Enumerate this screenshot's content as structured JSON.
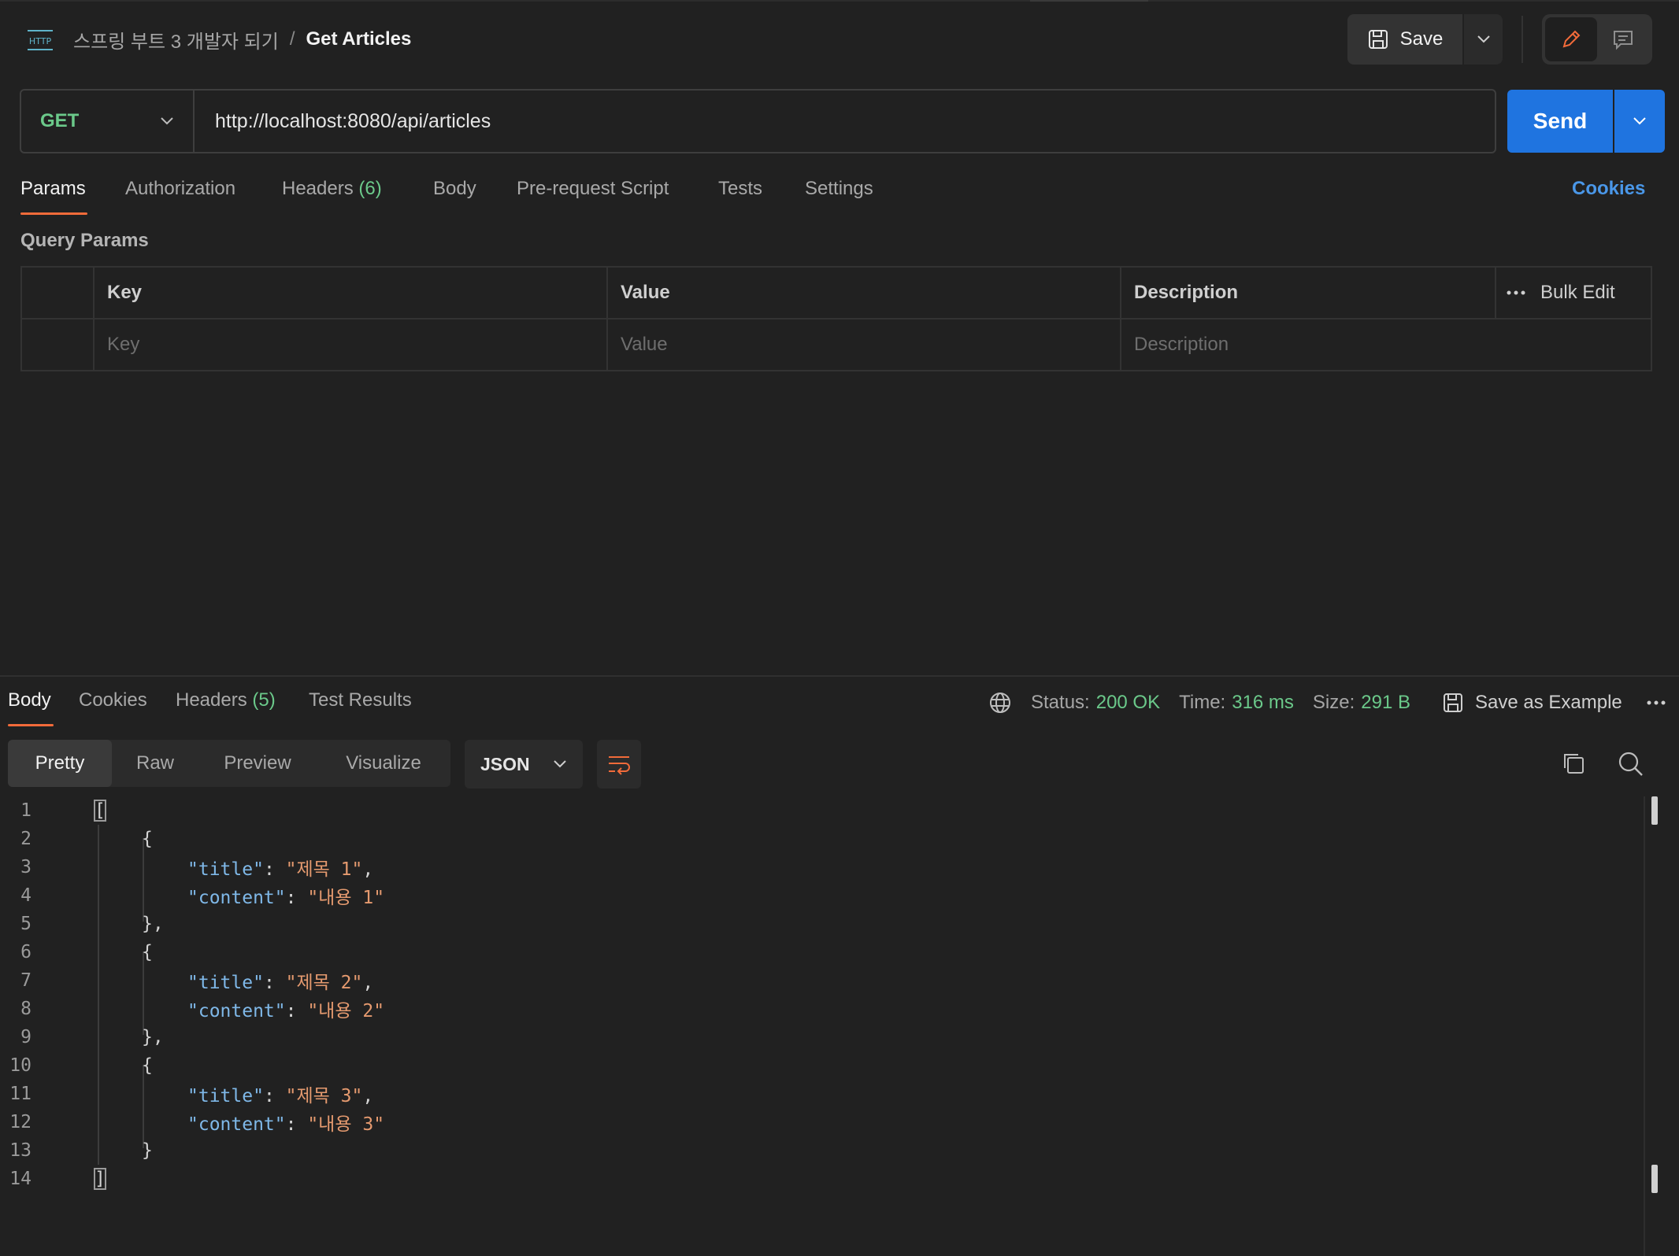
{
  "header": {
    "icon_text": "HTTP",
    "breadcrumb": [
      "스프링 부트 3 개발자 되기",
      "Get Articles"
    ],
    "separator": "/",
    "save_label": "Save"
  },
  "request": {
    "method": "GET",
    "url": "http://localhost:8080/api/articles",
    "send_label": "Send"
  },
  "request_tabs": {
    "params": "Params",
    "authorization": "Authorization",
    "headers": "Headers",
    "headers_count": "(6)",
    "body": "Body",
    "pre_request": "Pre-request Script",
    "tests": "Tests",
    "settings": "Settings",
    "cookies": "Cookies"
  },
  "query_params": {
    "title": "Query Params",
    "columns": {
      "key": "Key",
      "value": "Value",
      "description": "Description"
    },
    "bulk_edit": "Bulk Edit",
    "placeholders": {
      "key": "Key",
      "value": "Value",
      "description": "Description"
    }
  },
  "response_tabs": {
    "body": "Body",
    "cookies": "Cookies",
    "headers": "Headers",
    "headers_count": "(5)",
    "test_results": "Test Results"
  },
  "response_status": {
    "status_label": "Status:",
    "status_value": "200 OK",
    "time_label": "Time:",
    "time_value": "316 ms",
    "size_label": "Size:",
    "size_value": "291 B",
    "save_example": "Save as Example"
  },
  "view_modes": {
    "pretty": "Pretty",
    "raw": "Raw",
    "preview": "Preview",
    "visualize": "Visualize",
    "format": "JSON"
  },
  "code": {
    "line_numbers": [
      "1",
      "2",
      "3",
      "4",
      "5",
      "6",
      "7",
      "8",
      "9",
      "10",
      "11",
      "12",
      "13",
      "14"
    ],
    "l1": "[",
    "l2": "{",
    "l3_key": "\"title\"",
    "l3_val": "\"제목 1\"",
    "l4_key": "\"content\"",
    "l4_val": "\"내용 1\"",
    "l5": "},",
    "l6": "{",
    "l7_key": "\"title\"",
    "l7_val": "\"제목 2\"",
    "l8_key": "\"content\"",
    "l8_val": "\"내용 2\"",
    "l9": "},",
    "l10": "{",
    "l11_key": "\"title\"",
    "l11_val": "\"제목 3\"",
    "l12_key": "\"content\"",
    "l12_val": "\"내용 3\"",
    "l13": "}",
    "l14": "]",
    "colon": ": ",
    "comma": ","
  },
  "colors": {
    "accent_orange": "#f26b3a",
    "send_blue": "#1f74e0",
    "method_green": "#6bc98a",
    "link_blue": "#4a97e8"
  }
}
